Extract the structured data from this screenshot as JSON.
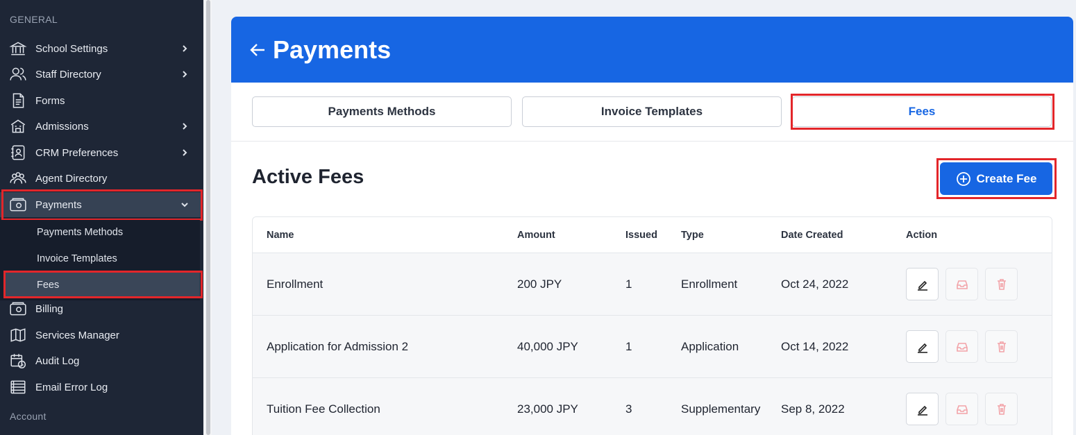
{
  "sidebar": {
    "section_general": "GENERAL",
    "section_account": "Account",
    "items": [
      {
        "label": "School Settings",
        "icon": "bank-icon"
      },
      {
        "label": "Staff Directory",
        "icon": "users-icon"
      },
      {
        "label": "Forms",
        "icon": "document-icon"
      },
      {
        "label": "Admissions",
        "icon": "school-icon"
      },
      {
        "label": "CRM Preferences",
        "icon": "contact-book-icon"
      },
      {
        "label": "Agent Directory",
        "icon": "group-icon"
      },
      {
        "label": "Payments",
        "icon": "payment-icon"
      },
      {
        "label": "Billing",
        "icon": "billing-icon"
      },
      {
        "label": "Services Manager",
        "icon": "map-icon"
      },
      {
        "label": "Audit Log",
        "icon": "calendar-clock-icon"
      },
      {
        "label": "Email Error Log",
        "icon": "list-icon"
      }
    ],
    "payments_sub": [
      {
        "label": "Payments Methods"
      },
      {
        "label": "Invoice Templates"
      },
      {
        "label": "Fees"
      }
    ]
  },
  "header": {
    "title": "Payments"
  },
  "tabs": [
    {
      "label": "Payments Methods"
    },
    {
      "label": "Invoice Templates"
    },
    {
      "label": "Fees"
    }
  ],
  "main": {
    "section_title": "Active Fees",
    "create_label": "Create Fee"
  },
  "table": {
    "columns": [
      "Name",
      "Amount",
      "Issued",
      "Type",
      "Date Created",
      "Action"
    ],
    "rows": [
      {
        "name": "Enrollment",
        "amount": "200 JPY",
        "issued": "1",
        "type": "Enrollment",
        "date": "Oct 24, 2022"
      },
      {
        "name": "Application for Admission 2",
        "amount": "40,000 JPY",
        "issued": "1",
        "type": "Application",
        "date": "Oct 14, 2022"
      },
      {
        "name": "Tuition Fee Collection",
        "amount": "23,000 JPY",
        "issued": "3",
        "type": "Supplementary",
        "date": "Sep 8, 2022"
      }
    ]
  },
  "colors": {
    "brand": "#1766e3",
    "sidebar_bg": "#1e2636",
    "highlight": "#e3262a",
    "danger_muted": "#f2a3a8"
  }
}
